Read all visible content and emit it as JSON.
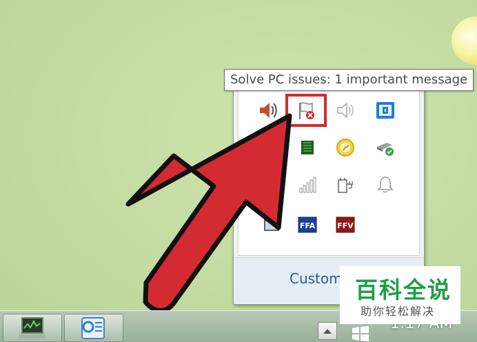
{
  "tooltip": {
    "text": "Solve PC issues: 1 important message"
  },
  "tray": {
    "footer_link": "Customiz",
    "icons": [
      "volume-icon",
      "action-center-flag-error-icon",
      "volume-muted-icon",
      "network-adapter-icon",
      "memory-chip-icon",
      "clock-widget-icon",
      "safely-remove-hardware-icon",
      "wifi-signal-icon",
      "power-plug-icon",
      "notification-bell-icon",
      "window-icon",
      "ffa-icon",
      "ffv-icon"
    ],
    "labels": {
      "ffa": "FFA",
      "ffv": "FFV"
    }
  },
  "taskbar": {
    "clock": "1:17 AM"
  },
  "watermark": {
    "title": "百科全说",
    "subtitle": "助你轻松解决"
  },
  "colors": {
    "arrow": "#d42b33",
    "highlight": "#d52a2f",
    "link": "#1e5ca8",
    "watermark_green": "#1e9e45"
  }
}
